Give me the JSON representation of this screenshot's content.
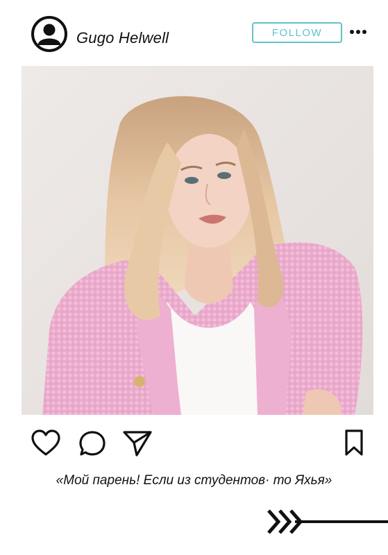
{
  "post": {
    "username": "Gugo Helwell",
    "follow_label": "FOLLOW",
    "caption": "«Мой парень! Если из студентов· то Яхья»"
  },
  "icons": {
    "avatar": "user-avatar-icon",
    "more": "more-horizontal-icon",
    "like": "heart-icon",
    "comment": "comment-bubble-icon",
    "share": "paper-plane-icon",
    "save": "bookmark-icon",
    "decoration": "arrow-icon"
  },
  "colors": {
    "accent": "#5fc3c9",
    "text": "#111111",
    "background": "#ffffff"
  }
}
